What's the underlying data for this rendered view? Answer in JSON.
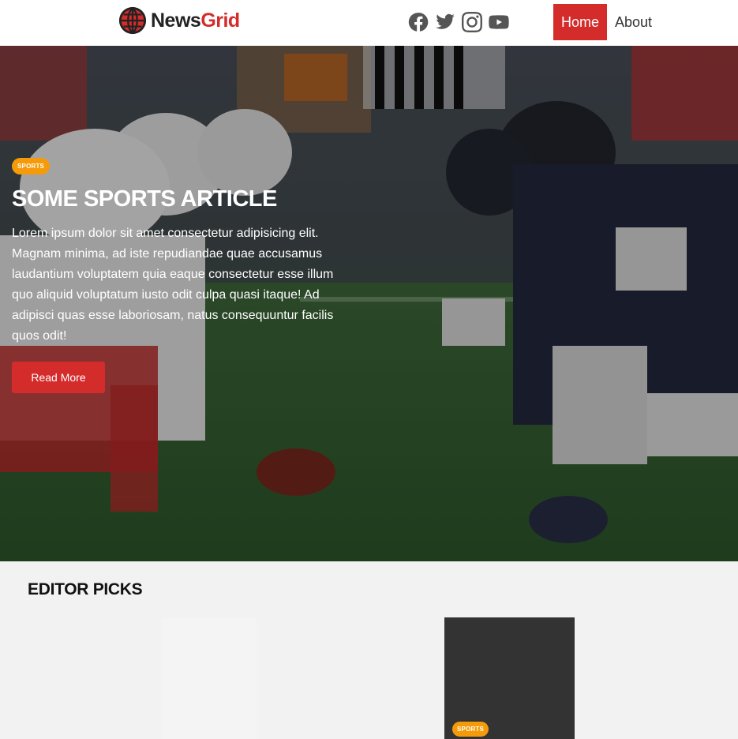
{
  "brand": {
    "part1": "News",
    "part2": "Grid",
    "accent": "#d42b2b"
  },
  "socials": [
    {
      "icon": "facebook-icon"
    },
    {
      "icon": "twitter-icon"
    },
    {
      "icon": "instagram-icon"
    },
    {
      "icon": "youtube-icon"
    }
  ],
  "nav": {
    "home": "Home",
    "about": "About"
  },
  "hero": {
    "badge": "SPORTS",
    "title": "SOME SPORTS ARTICLE",
    "text": "Lorem ipsum dolor sit amet consectetur adipisicing elit. Magnam minima, ad iste repudiandae quae accusamus laudantium voluptatem quia eaque consectetur esse illum quo aliquid voluptatum iusto odit culpa quasi itaque! Ad adipisci quas esse laboriosam, natus consequuntur facilis quos odit!",
    "button": "Read More",
    "badge_color": "#f59b0a"
  },
  "editor_picks": {
    "title": "EDITOR PICKS",
    "card_badge": "SPORTS"
  }
}
